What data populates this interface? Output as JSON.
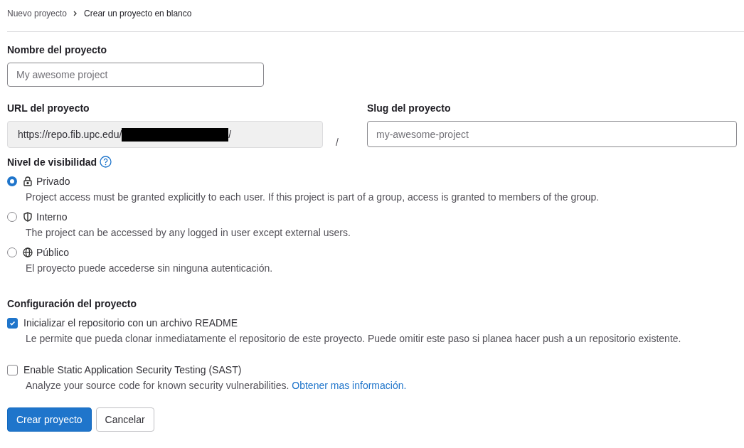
{
  "breadcrumb": [
    {
      "label": "Nuevo proyecto",
      "current": false
    },
    {
      "label": "Crear un proyecto en blanco",
      "current": true
    }
  ],
  "name_field": {
    "label": "Nombre del proyecto",
    "placeholder": "My awesome project"
  },
  "url_field": {
    "label": "URL del proyecto",
    "prefix": "https://repo.fib.upc.edu/",
    "suffix": "/"
  },
  "separator": "/",
  "slug_field": {
    "label": "Slug del proyecto",
    "placeholder": "my-awesome-project"
  },
  "visibility": {
    "label": "Nivel de visibilidad",
    "options": [
      {
        "label": "Privado",
        "kind": "private",
        "selected": true,
        "description": "Project access must be granted explicitly to each user. If this project is part of a group, access is granted to members of the group."
      },
      {
        "label": "Interno",
        "kind": "internal",
        "selected": false,
        "description": "The project can be accessed by any logged in user except external users."
      },
      {
        "label": "Público",
        "kind": "public",
        "selected": false,
        "description": "El proyecto puede accederse sin ninguna autenticación."
      }
    ]
  },
  "configuration": {
    "label": "Configuración del proyecto",
    "options": [
      {
        "label": "Inicializar el repositorio con un archivo README",
        "checked": true,
        "description": "Le permite que pueda clonar inmediatamente el repositorio de este proyecto. Puede omitir este paso si planea hacer push a un repositorio existente."
      },
      {
        "label": "Enable Static Application Security Testing (SAST)",
        "checked": false,
        "description": "Analyze your source code for known security vulnerabilities.",
        "link": "Obtener mas información."
      }
    ]
  },
  "buttons": [
    {
      "label": "Crear proyecto",
      "kind": "primary"
    },
    {
      "label": "Cancelar",
      "kind": "secondary"
    }
  ]
}
